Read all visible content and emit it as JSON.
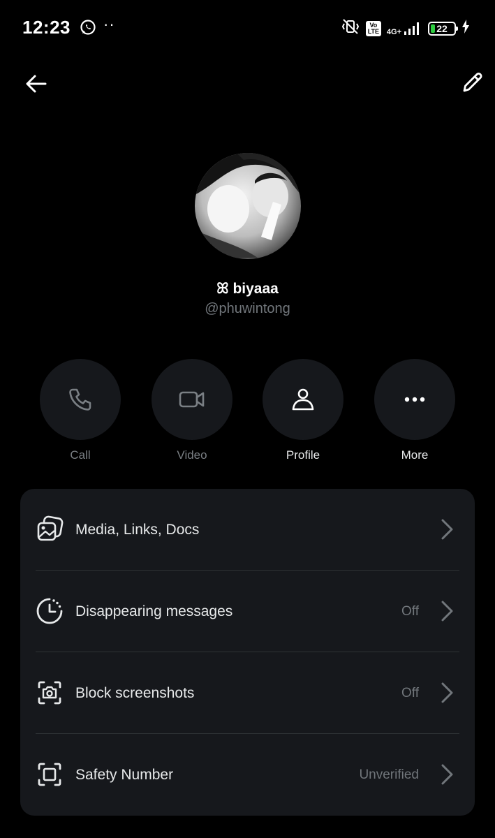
{
  "status_bar": {
    "time": "12:23",
    "volte": "Vo LTE",
    "network": "4G+",
    "battery": "22"
  },
  "profile": {
    "display_name": "ꕤ biyaaa",
    "handle": "@phuwintong"
  },
  "actions": [
    {
      "label": "Call",
      "icon": "phone-icon"
    },
    {
      "label": "Video",
      "icon": "video-icon"
    },
    {
      "label": "Profile",
      "icon": "person-icon"
    },
    {
      "label": "More",
      "icon": "ellipsis-icon"
    }
  ],
  "settings": [
    {
      "label": "Media, Links, Docs",
      "value": "",
      "icon": "media-icon"
    },
    {
      "label": "Disappearing messages",
      "value": "Off",
      "icon": "timer-icon"
    },
    {
      "label": "Block screenshots",
      "value": "Off",
      "icon": "camera-focus-icon"
    },
    {
      "label": "Safety Number",
      "value": "Unverified",
      "icon": "shield-frame-icon"
    }
  ],
  "colors": {
    "background": "#000000",
    "surface": "#16181c",
    "muted": "#71767b",
    "text": "#e7e9ea",
    "battery_fill": "#2ecc40"
  }
}
